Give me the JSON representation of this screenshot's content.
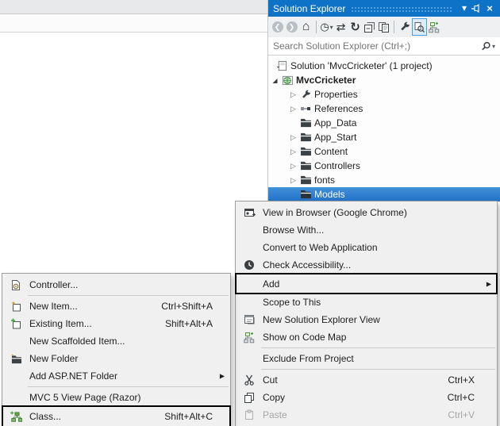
{
  "solution_explorer": {
    "title": "Solution Explorer",
    "window_buttons": {
      "menu": "window-position-menu",
      "pin": "auto-hide-pin",
      "close": "close"
    },
    "toolbar_icons": [
      "back",
      "forward",
      "home",
      "pending-changes-filter",
      "sync-with-active-document",
      "refresh",
      "collapse-all",
      "show-all-files",
      "properties",
      "preview-selected-items",
      "show-on-code-map"
    ],
    "search": {
      "placeholder": "Search Solution Explorer (Ctrl+;)"
    },
    "tree": {
      "items": [
        {
          "label": "Solution 'MvcCricketer' (1 project)",
          "icon": "solution-icon",
          "level": 0
        },
        {
          "label": "MvcCricketer",
          "icon": "project-icon",
          "level": 1,
          "expanded": true,
          "bold": true
        },
        {
          "label": "Properties",
          "icon": "wrench-icon",
          "level": 2,
          "collapsed": true
        },
        {
          "label": "References",
          "icon": "references-icon",
          "level": 2,
          "collapsed": true
        },
        {
          "label": "App_Data",
          "icon": "folder-icon",
          "level": 2
        },
        {
          "label": "App_Start",
          "icon": "folder-icon",
          "level": 2,
          "collapsed": true
        },
        {
          "label": "Content",
          "icon": "folder-icon",
          "level": 2,
          "collapsed": true
        },
        {
          "label": "Controllers",
          "icon": "folder-icon",
          "level": 2,
          "collapsed": true
        },
        {
          "label": "fonts",
          "icon": "folder-icon",
          "level": 2,
          "collapsed": true
        },
        {
          "label": "Models",
          "icon": "folder-icon",
          "level": 2,
          "selected": true
        }
      ]
    }
  },
  "context_menu": {
    "items": [
      {
        "label": "View in Browser (Google Chrome)",
        "icon": "browser-icon"
      },
      {
        "label": "Browse With..."
      },
      {
        "label": "Convert to Web Application"
      },
      {
        "label": "Check Accessibility...",
        "icon": "accessibility-icon"
      },
      {
        "label": "Add",
        "has_submenu": true,
        "highlighted": true
      },
      {
        "label": "Scope to This"
      },
      {
        "label": "New Solution Explorer View",
        "icon": "new-view-icon"
      },
      {
        "label": "Show on Code Map",
        "icon": "code-map-icon"
      },
      {
        "label": "Exclude From Project"
      },
      {
        "label": "Cut",
        "shortcut": "Ctrl+X",
        "icon": "cut-icon"
      },
      {
        "label": "Copy",
        "shortcut": "Ctrl+C",
        "icon": "copy-icon"
      },
      {
        "label": "Paste",
        "shortcut": "Ctrl+V",
        "icon": "paste-icon",
        "disabled": true
      }
    ]
  },
  "add_submenu": {
    "items": [
      {
        "label": "Controller...",
        "icon": "controller-icon"
      },
      {
        "label": "New Item...",
        "shortcut": "Ctrl+Shift+A",
        "icon": "new-item-icon"
      },
      {
        "label": "Existing Item...",
        "shortcut": "Shift+Alt+A",
        "icon": "existing-item-icon"
      },
      {
        "label": "New Scaffolded Item..."
      },
      {
        "label": "New Folder",
        "icon": "new-folder-icon"
      },
      {
        "label": "Add ASP.NET Folder",
        "has_submenu": true
      },
      {
        "label": "MVC 5 View Page (Razor)"
      },
      {
        "label": "Class...",
        "shortcut": "Shift+Alt+C",
        "icon": "class-icon",
        "highlighted": true
      }
    ]
  },
  "icons": {
    "chevron_down": "▾",
    "close": "×",
    "back": "❮",
    "forward": "❯",
    "home": "⌂",
    "clock": "◷",
    "caret": "▾",
    "sync": "⇄",
    "refresh": "↻",
    "tree_expanded": "◢",
    "tree_collapsed": "▷",
    "submenu_arrow": "▶"
  },
  "colors": {
    "titlebar": "#0e73c6",
    "selection": "#2e7fd2",
    "menu_background": "#f0f0f1",
    "highlight_border": "#000000"
  }
}
